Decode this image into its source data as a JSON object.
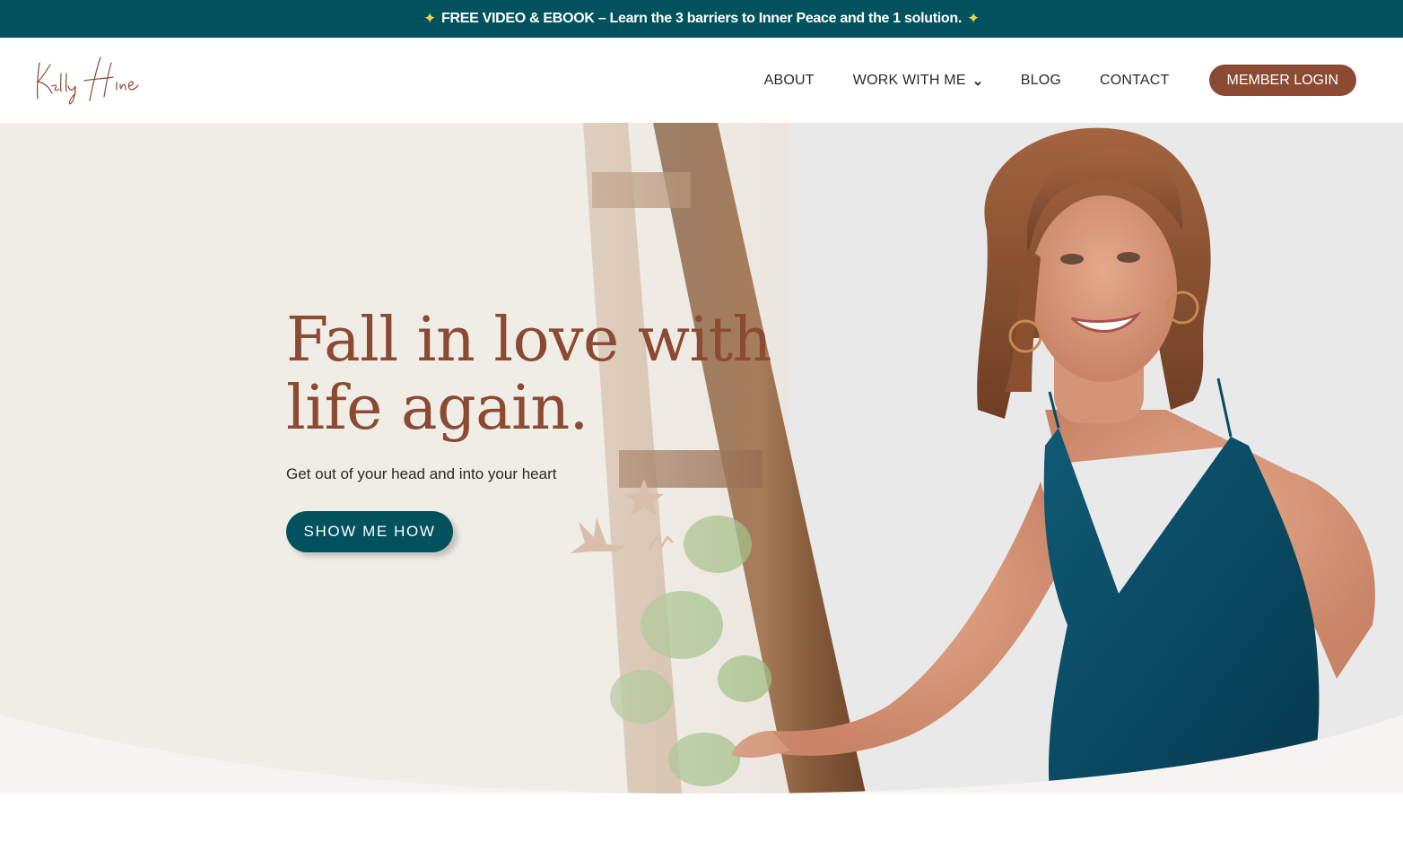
{
  "announcement": {
    "text": "FREE VIDEO & EBOOK – Learn the 3 barriers to Inner Peace and the 1 solution.",
    "icon": "sparkles-icon"
  },
  "logo": {
    "text": "Kelly Hine"
  },
  "nav": {
    "items": [
      {
        "label": "ABOUT"
      },
      {
        "label": "WORK WITH ME",
        "has_dropdown": true
      },
      {
        "label": "BLOG"
      },
      {
        "label": "CONTACT"
      }
    ],
    "login_label": "MEMBER LOGIN"
  },
  "hero": {
    "headline_line1": "Fall in love with",
    "headline_line2": "life again.",
    "subheadline": "Get out of your head and into your heart",
    "cta_label": "SHOW ME HOW"
  },
  "colors": {
    "teal": "#02525e",
    "brown": "#8b4a32",
    "cream": "#f0ece6"
  }
}
